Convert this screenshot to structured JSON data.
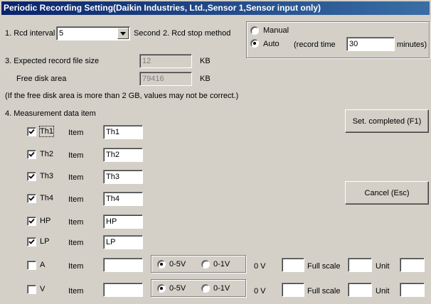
{
  "window": {
    "title": "Periodic Recording Setting(Daikin Industries, Ltd.,Sensor 1,Sensor input only)"
  },
  "interval": {
    "label": "1. Rcd interval",
    "value": "5",
    "unit": "Second"
  },
  "stop_method": {
    "label": "2. Rcd stop method",
    "manual_label": "Manual",
    "auto_label": "Auto",
    "record_time_label": "(record time",
    "record_time_value": "30",
    "record_time_unit": "minutes)",
    "selected": "auto"
  },
  "file_size": {
    "label": "3. Expected record file size",
    "value": "12",
    "unit": "KB"
  },
  "free_disk": {
    "label": "Free disk area",
    "value": "79416",
    "unit": "KB"
  },
  "note": "(If the free disk area is more than 2 GB, values may not be correct.)",
  "measurement": {
    "label": "4. Measurement data item",
    "item_label": "Item",
    "rows": [
      {
        "name": "Th1",
        "checked": true,
        "item": "Th1"
      },
      {
        "name": "Th2",
        "checked": true,
        "item": "Th2"
      },
      {
        "name": "Th3",
        "checked": true,
        "item": "Th3"
      },
      {
        "name": "Th4",
        "checked": true,
        "item": "Th4"
      },
      {
        "name": "HP",
        "checked": true,
        "item": "HP"
      },
      {
        "name": "LP",
        "checked": true,
        "item": "LP"
      }
    ],
    "analog_rows": [
      {
        "name": "A",
        "checked": false,
        "item": "",
        "range_a": "0-5V",
        "range_b": "0-1V",
        "selected": "0-5V",
        "zero_label": "0 V",
        "zero_value": "",
        "full_label": "Full scale",
        "full_value": "",
        "unit_label": "Unit",
        "unit_value": ""
      },
      {
        "name": "V",
        "checked": false,
        "item": "",
        "range_a": "0-5V",
        "range_b": "0-1V",
        "selected": "0-5V",
        "zero_label": "0 V",
        "zero_value": "",
        "full_label": "Full scale",
        "full_value": "",
        "unit_label": "Unit",
        "unit_value": ""
      }
    ]
  },
  "buttons": {
    "set_completed": "Set. completed (F1)",
    "cancel": "Cancel (Esc)"
  }
}
